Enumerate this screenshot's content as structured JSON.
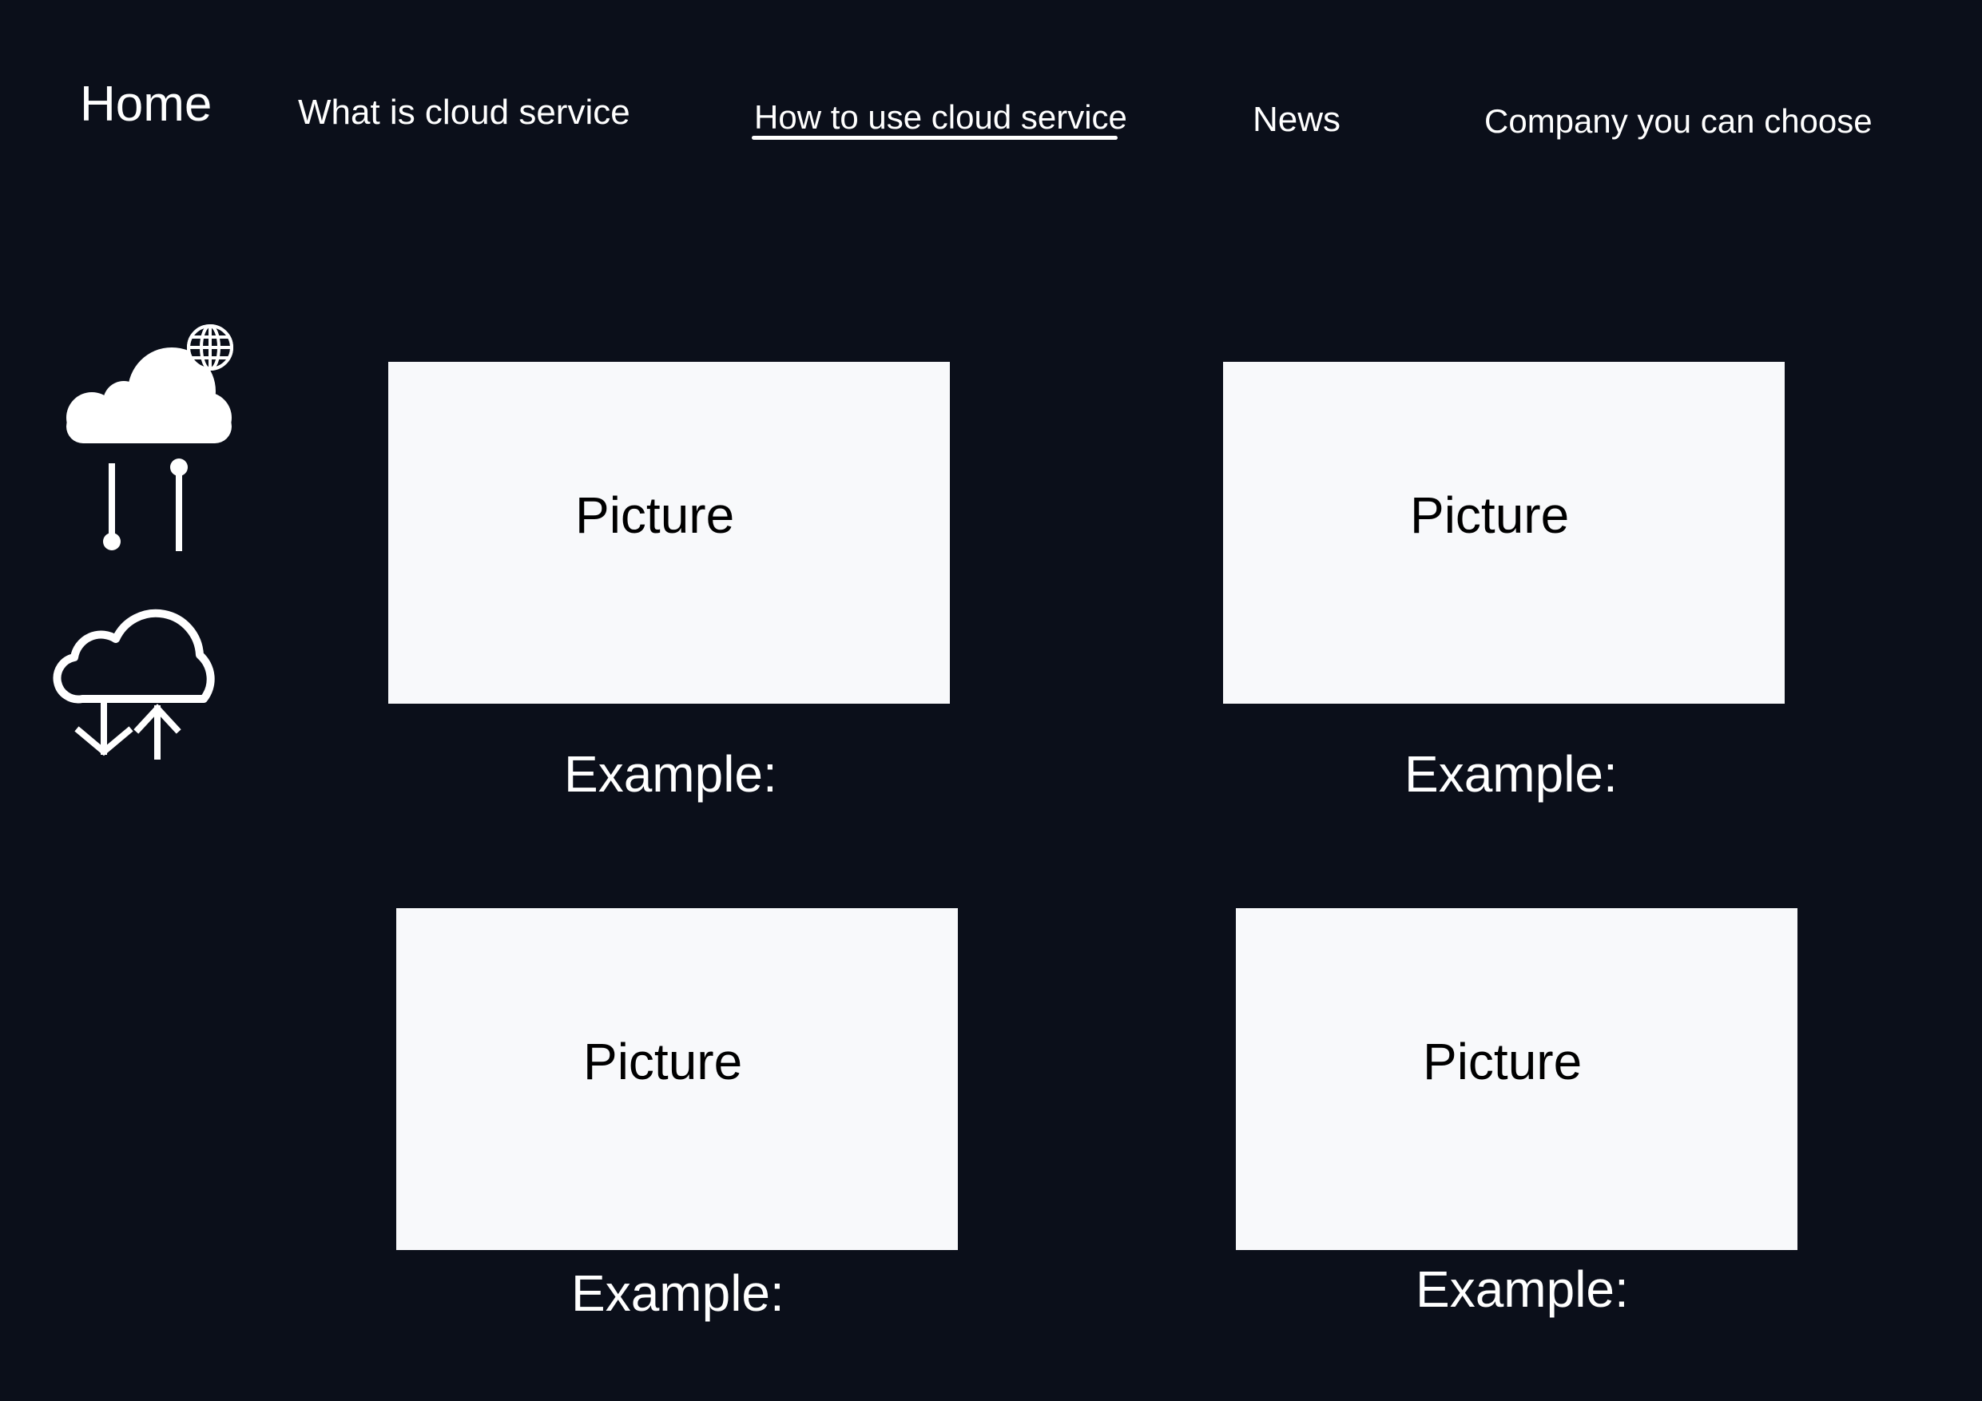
{
  "nav": {
    "home": "Home",
    "what_is": "What is cloud service",
    "how_to_use": "How to use cloud service",
    "news": "News",
    "company": "Company you can choose",
    "active_item": "How to use cloud service"
  },
  "icons": {
    "top": "cloud-network-icon",
    "bottom": "cloud-sync-icon"
  },
  "cards": [
    {
      "picture_label": "Picture",
      "example_label": "Example:"
    },
    {
      "picture_label": "Picture",
      "example_label": "Example:"
    },
    {
      "picture_label": "Picture",
      "example_label": "Example:"
    },
    {
      "picture_label": "Picture",
      "example_label": "Example:"
    }
  ],
  "colors": {
    "background": "#0b0f1a",
    "text": "#ffffff",
    "picture_box": "#f8f9fb",
    "picture_text": "#000000"
  }
}
